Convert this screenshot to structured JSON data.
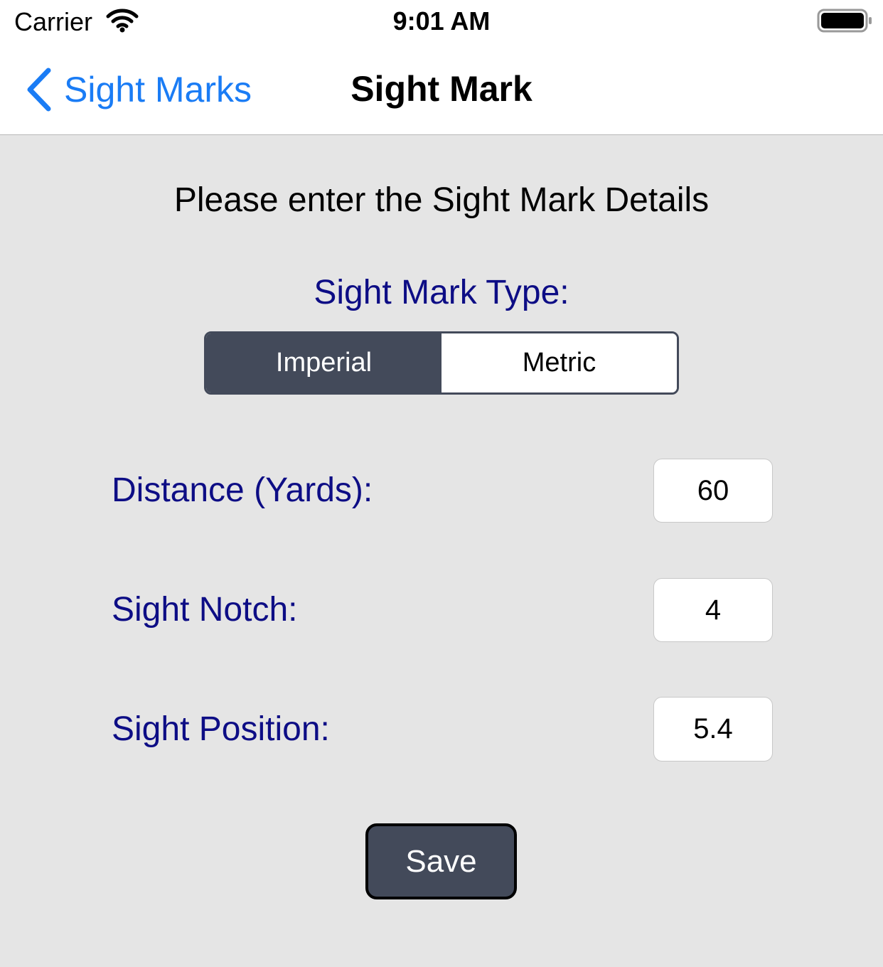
{
  "status_bar": {
    "carrier": "Carrier",
    "time": "9:01 AM",
    "wifi_icon": "wifi-icon",
    "battery_icon": "battery-full-icon"
  },
  "nav": {
    "back_icon": "chevron-left-icon",
    "back_label": "Sight Marks",
    "title": "Sight Mark"
  },
  "form": {
    "instructions": "Please enter the Sight Mark Details",
    "type_label": "Sight Mark Type:",
    "type_options": [
      "Imperial",
      "Metric"
    ],
    "type_selected": "Imperial",
    "fields": [
      {
        "label": "Distance (Yards):",
        "value": "60"
      },
      {
        "label": "Sight Notch:",
        "value": "4"
      },
      {
        "label": "Sight Position:",
        "value": "5.4"
      }
    ],
    "save_label": "Save"
  },
  "colors": {
    "accent_blue": "#1a7cf5",
    "label_navy": "#0d0d85",
    "control_dark": "#434a5a",
    "background": "#e5e5e5"
  }
}
